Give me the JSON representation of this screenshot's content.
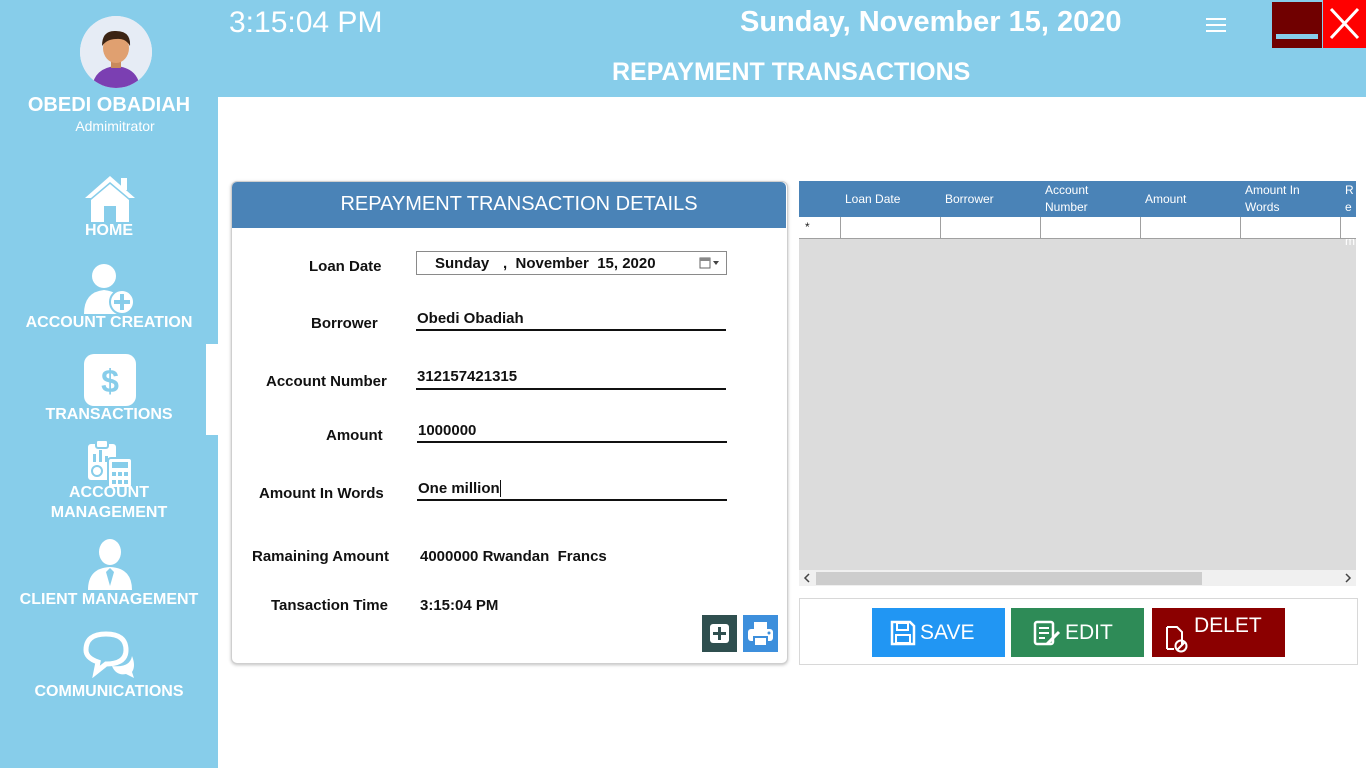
{
  "header": {
    "time": "3:15:04 PM",
    "date": "Sunday, November 15, 2020",
    "title": "REPAYMENT TRANSACTIONS"
  },
  "user": {
    "name": "OBEDI OBADIAH",
    "role": "Admimitrator"
  },
  "sidebar": {
    "items": [
      {
        "label": "HOME",
        "icon": "home-icon"
      },
      {
        "label": "ACCOUNT CREATION",
        "icon": "add-user-icon"
      },
      {
        "label": "TRANSACTIONS",
        "icon": "dollar-icon",
        "active": true
      },
      {
        "label": "ACCOUNT",
        "label2": "MANAGEMENT",
        "icon": "calculator-icon"
      },
      {
        "label": "CLIENT MANAGEMENT",
        "icon": "client-icon"
      },
      {
        "label": "COMMUNICATIONS",
        "icon": "chat-icon"
      }
    ]
  },
  "form": {
    "title": "REPAYMENT TRANSACTION DETAILS",
    "loan_date_label": "Loan Date",
    "loan_date_day": "Sunday",
    "loan_date_rest": ",  November  15, 2020",
    "borrower_label": "Borrower",
    "borrower_value": "Obedi Obadiah",
    "account_number_label": "Account Number",
    "account_number_value": "312157421315",
    "amount_label": "Amount",
    "amount_value": "1000000",
    "amount_words_label": "Amount In Words",
    "amount_words_value": "One million",
    "remaining_label": "Ramaining Amount",
    "remaining_value": "4000000 Rwandan  Francs",
    "time_label": "Tansaction Time",
    "time_value": "3:15:04 PM"
  },
  "grid": {
    "columns": [
      "Loan Date",
      "Borrower",
      "Account Number",
      "Amount",
      "Amount In Words",
      "Re Am"
    ],
    "new_row_marker": "*"
  },
  "actions": {
    "save": "SAVE",
    "edit": "EDIT",
    "delete": "DELET"
  },
  "colors": {
    "sidebar": "#87cdea",
    "panel_header": "#4a83b7",
    "save": "#2196f3",
    "edit": "#2e8b57",
    "delete": "#8b0000",
    "close": "#ff0000"
  }
}
